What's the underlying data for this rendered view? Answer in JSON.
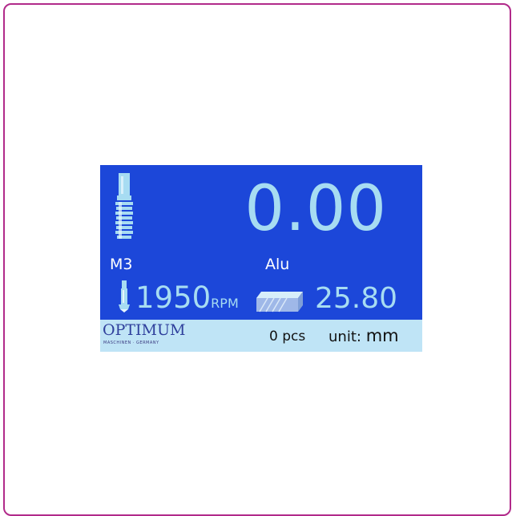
{
  "display": {
    "main_value": "0.00",
    "tap_size": "M3",
    "material": "Alu",
    "speed_value": "1950",
    "speed_unit": "RPM",
    "length_value": "25.80",
    "piece_count": "0 pcs",
    "unit_label": "unit:",
    "unit_value": "mm"
  },
  "branding": {
    "logo_text": "OPTIMUM",
    "logo_subtext": "MASCHINEN · GERMANY"
  },
  "icons": {
    "tap": "tap-tool-icon",
    "drill": "drill-bit-icon",
    "workpiece": "workpiece-block-icon"
  },
  "colors": {
    "frame_border": "#b12a8a",
    "screen_background": "#1c47d9",
    "value_text": "#a7dcf2",
    "footer_background": "#bfe4f6",
    "logo": "#2f3f9c"
  }
}
